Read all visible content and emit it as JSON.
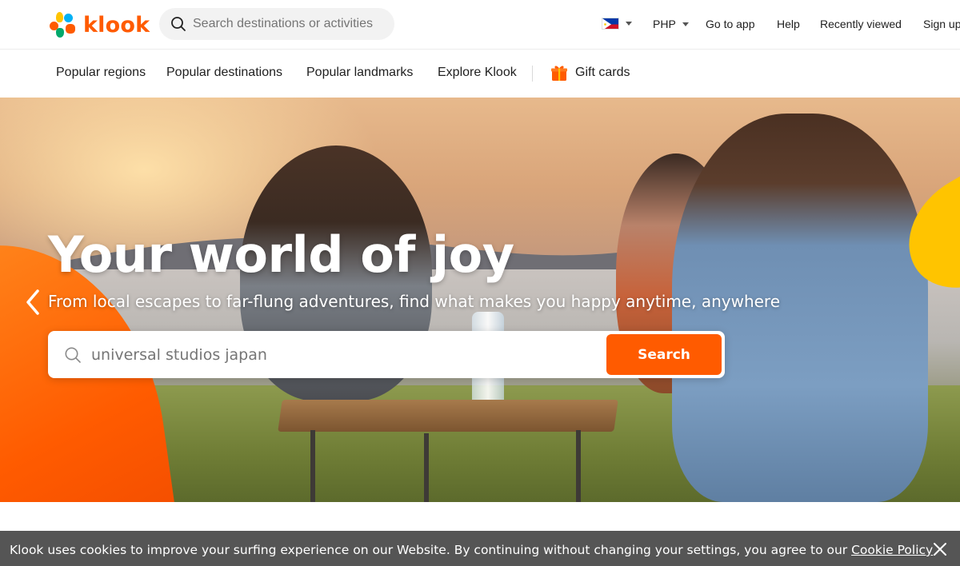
{
  "brand": {
    "name": "klook",
    "accent_color": "#ff5b00",
    "logo_icon": "klook-logo-icon"
  },
  "header": {
    "search": {
      "placeholder": "Search destinations or activities",
      "icon": "search-icon"
    },
    "locale": {
      "flag_icon": "philippines-flag-icon"
    },
    "currency": "PHP",
    "links": {
      "go_to_app": "Go to app",
      "help": "Help",
      "recently_viewed": "Recently viewed",
      "sign_up": "Sign up"
    }
  },
  "sub_nav": {
    "items": [
      {
        "label": "Popular regions"
      },
      {
        "label": "Popular destinations"
      },
      {
        "label": "Popular landmarks"
      },
      {
        "label": "Explore Klook"
      }
    ],
    "gift_cards": {
      "label": "Gift cards",
      "icon": "gift-icon"
    }
  },
  "hero": {
    "title": "Your world of joy",
    "subtitle": "From local escapes to far-flung adventures, find what makes you happy anytime, anywhere",
    "search": {
      "placeholder": "universal studios japan",
      "button_label": "Search"
    },
    "prev_icon": "chevron-left-icon"
  },
  "cookie_banner": {
    "text": "Klook uses cookies to improve your surfing experience on our Website. By continuing without changing your settings, you agree to our ",
    "link_label": "Cookie Policy",
    "close_icon": "close-icon",
    "background": "#555555"
  }
}
